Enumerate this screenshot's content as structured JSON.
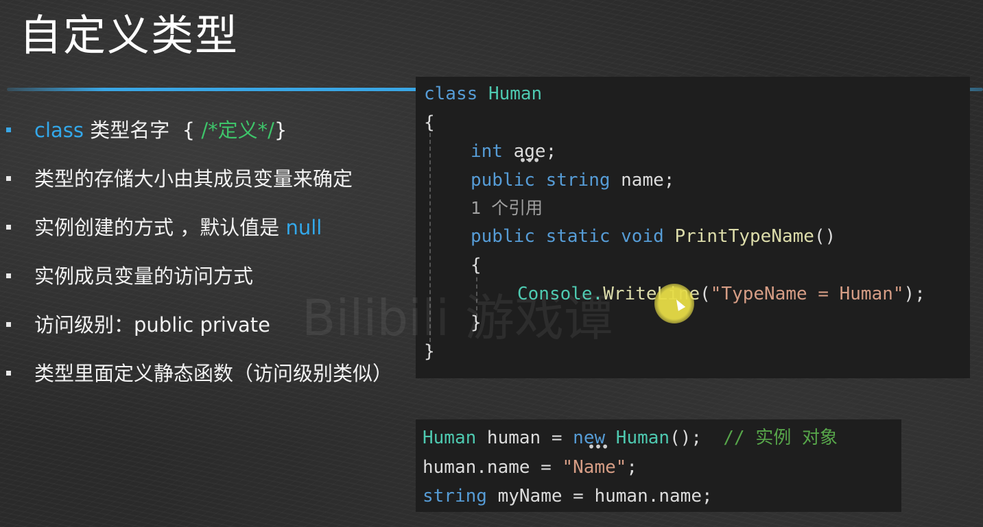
{
  "slide": {
    "title": "自定义类型",
    "bullets": [
      {
        "kw": "class",
        "mid": " 类型名字  { ",
        "comment": "/*定义*/",
        "tail": "}"
      },
      {
        "text": "类型的存储大小由其成员变量来确定"
      },
      {
        "text": "实例创建的方式 ，默认值是 ",
        "highlight": "null"
      },
      {
        "text": "实例成员变量的访问方式"
      },
      {
        "text": "访问级别：public  private"
      },
      {
        "text": "类型里面定义静态函数（访问级别类似）"
      }
    ],
    "watermark": "Bilibili 游戏谭"
  },
  "code_block_1": {
    "line1_kw": "class",
    "line1_name": "Human",
    "open_brace": "{",
    "line3_kw": "int",
    "line3_var": "age;",
    "line4_kw1": "public",
    "line4_kw2": "string",
    "line4_var": "name;",
    "ref_count": "1 个引用",
    "line6_kw1": "public",
    "line6_kw2": "static",
    "line6_kw3": "void",
    "line6_fn": "PrintTypeName",
    "line6_paren": "()",
    "inner_open": "{",
    "line8_type": "Console.",
    "line8_fn": "WriteLine",
    "line8_open": "(",
    "line8_str": "\"TypeName = Human\"",
    "line8_close": ");",
    "inner_close": "}",
    "close_brace": "}"
  },
  "code_block_2": {
    "l1_type": "Human",
    "l1_var": " human = ",
    "l1_kw": "new",
    "l1_type2": "Human",
    "l1_paren": "();",
    "l1_comment": "// 实例 对象",
    "l2_var": "human.name = ",
    "l2_str": "\"Name\"",
    "l2_end": ";",
    "l3_kw": "string",
    "l3_var": " myName = human.name;"
  },
  "colors": {
    "accent_blue": "#3aa7e6",
    "keyword": "#569cd6",
    "type": "#4ec9b0",
    "string": "#d69d85",
    "comment": "#57a64a",
    "cursor_highlight": "#e6dc46"
  }
}
